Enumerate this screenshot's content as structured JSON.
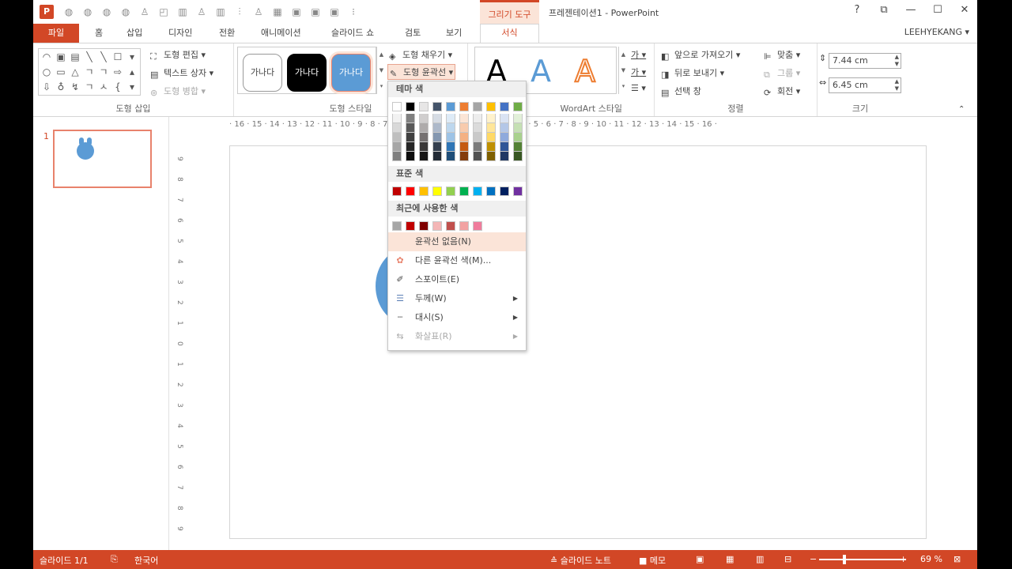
{
  "titlebar": {
    "app_logo": "P",
    "drawing_tools": "그리기 도구",
    "doc_title": "프레젠테이션1 - PowerPoint",
    "help": "?",
    "ribbon_display": "⧉",
    "minimize": "—",
    "maximize": "☐",
    "close": "✕"
  },
  "tabs": {
    "file": "파일",
    "home": "홈",
    "insert": "삽입",
    "design": "디자인",
    "transitions": "전환",
    "animations": "애니메이션",
    "slideshow": "슬라이드 쇼",
    "review": "검토",
    "view": "보기",
    "format": "서식",
    "user": "LEEHYEKANG ▾"
  },
  "ribbon": {
    "insert_shapes": {
      "label": "도형 삽입",
      "shapes": [
        "◠",
        "▣",
        "▤",
        "╲",
        "╲",
        "☐",
        "▾",
        "○",
        "▭",
        "△",
        "ㄱ",
        "ㄱ",
        "⇨",
        "▴",
        "⇩",
        "♁",
        "↯",
        "ㄱ",
        "ㅅ",
        "{",
        "▾"
      ],
      "edit_shape": "도형 편집 ▾",
      "text_box": "텍스트 상자 ▾",
      "merge_shapes": "도형 병합 ▾"
    },
    "shape_styles": {
      "label": "도형 스타일",
      "samples": [
        "가나다",
        "가나다",
        "가나다"
      ],
      "fill": "도형 채우기 ▾",
      "outline": "도형 윤곽선 ▾"
    },
    "wordart": {
      "label": "WordArt 스타일",
      "letters": [
        "A",
        "A",
        "A"
      ],
      "text_fill_icon": "가",
      "text_outline_icon": "가"
    },
    "arrange": {
      "label": "정렬",
      "bring_forward": "앞으로 가져오기 ▾",
      "send_backward": "뒤로 보내기 ▾",
      "selection_pane": "선택 창",
      "align": "맞춤 ▾",
      "group": "그룹 ▾",
      "rotate": "회전 ▾"
    },
    "size": {
      "label": "크기",
      "height": "7.44 cm",
      "width": "6.45 cm"
    }
  },
  "thumbs": {
    "slide_number": "1"
  },
  "rulers": {
    "horizontal": "· 16 · 15 · 14 · 13 · 12 · 11 · 10 · 9 · 8 · 7 · 6 · 5 · 4 · 3 · 2 · 1 · 0 · 1 · 2 · 3 · 4 · 5 · 6 · 7 · 8 · 9 · 10 · 11 · 12 · 13 · 14 · 15 · 16 ·",
    "vertical": [
      "9",
      "8",
      "7",
      "6",
      "5",
      "4",
      "3",
      "2",
      "1",
      "0",
      "1",
      "2",
      "3",
      "4",
      "5",
      "6",
      "7",
      "8",
      "9"
    ]
  },
  "dropdown": {
    "theme_colors_header": "테마 색",
    "theme_colors": [
      "#ffffff",
      "#000000",
      "#e7e6e6",
      "#44546a",
      "#5b9bd5",
      "#ed7d31",
      "#a5a5a5",
      "#ffc000",
      "#4472c4",
      "#70ad47"
    ],
    "theme_shades": [
      [
        "#f2f2f2",
        "#d9d9d9",
        "#bfbfbf",
        "#a6a6a6",
        "#808080"
      ],
      [
        "#808080",
        "#595959",
        "#404040",
        "#262626",
        "#0d0d0d"
      ],
      [
        "#d0cece",
        "#aeabab",
        "#757171",
        "#3a3838",
        "#171616"
      ],
      [
        "#d6dce4",
        "#adb9ca",
        "#8497b0",
        "#333f4f",
        "#222a35"
      ],
      [
        "#deebf7",
        "#bdd7ee",
        "#9dc3e6",
        "#2e75b6",
        "#1f4e79"
      ],
      [
        "#fbe5d6",
        "#f8cbad",
        "#f4b183",
        "#c55a11",
        "#843c0c"
      ],
      [
        "#ededed",
        "#dbdbdb",
        "#c9c9c9",
        "#7b7b7b",
        "#525252"
      ],
      [
        "#fff2cc",
        "#ffe699",
        "#ffd966",
        "#bf9000",
        "#7f6000"
      ],
      [
        "#dae3f3",
        "#b4c7e7",
        "#8faadc",
        "#2f5597",
        "#203864"
      ],
      [
        "#e2f0d9",
        "#c5e0b4",
        "#a9d18e",
        "#548235",
        "#385723"
      ]
    ],
    "standard_colors_header": "표준 색",
    "standard_colors": [
      "#c00000",
      "#ff0000",
      "#ffc000",
      "#ffff00",
      "#92d050",
      "#00b050",
      "#00b0f0",
      "#0070c0",
      "#002060",
      "#7030a0"
    ],
    "recent_colors_header": "최근에 사용한 색",
    "recent_colors": [
      "#a6a6a6",
      "#c00000",
      "#7f0000",
      "#f4b6b6",
      "#c0504d",
      "#f2a2a2",
      "#f07c9c"
    ],
    "no_outline": "윤곽선 없음(N)",
    "more_colors": "다른 윤곽선 색(M)...",
    "eyedropper": "스포이트(E)",
    "weight": "두께(W)",
    "dashes": "대시(S)",
    "arrows": "화살표(R)"
  },
  "status": {
    "slide": "슬라이드 1/1",
    "language": "한국어",
    "notes": "슬라이드 노트",
    "comments": "메모",
    "zoom_out": "−",
    "zoom_in": "+",
    "zoom": "69 %"
  },
  "colors": {
    "accent": "#d24726",
    "shape_blue": "#5b9bd5"
  }
}
